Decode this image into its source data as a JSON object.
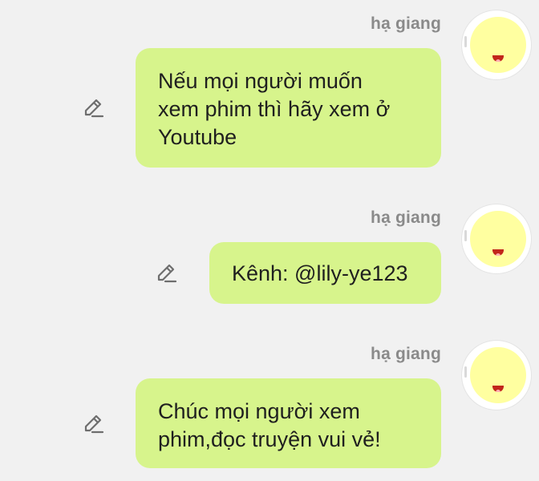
{
  "messages": [
    {
      "sender": "hạ giang",
      "lines": [
        "Nếu mọi người muốn",
        "xem phim thì hãy xem ở",
        "Youtube"
      ],
      "avatar_icon": "smiley-avatar-icon",
      "edit_icon": "pencil-icon"
    },
    {
      "sender": "hạ giang",
      "lines": [
        "Kênh: @lily-ye123"
      ],
      "avatar_icon": "smiley-avatar-icon",
      "edit_icon": "pencil-icon"
    },
    {
      "sender": "hạ giang",
      "lines": [
        "Chúc mọi người xem",
        "phim,đọc truyện vui vẻ!"
      ],
      "avatar_icon": "smiley-avatar-icon",
      "edit_icon": "pencil-icon"
    }
  ],
  "colors": {
    "background": "#f1f1f1",
    "bubble": "#d7f48c",
    "sender_name": "#8a8a8a",
    "avatar_face": "#ffffa0",
    "mouth": "#c2261b"
  }
}
